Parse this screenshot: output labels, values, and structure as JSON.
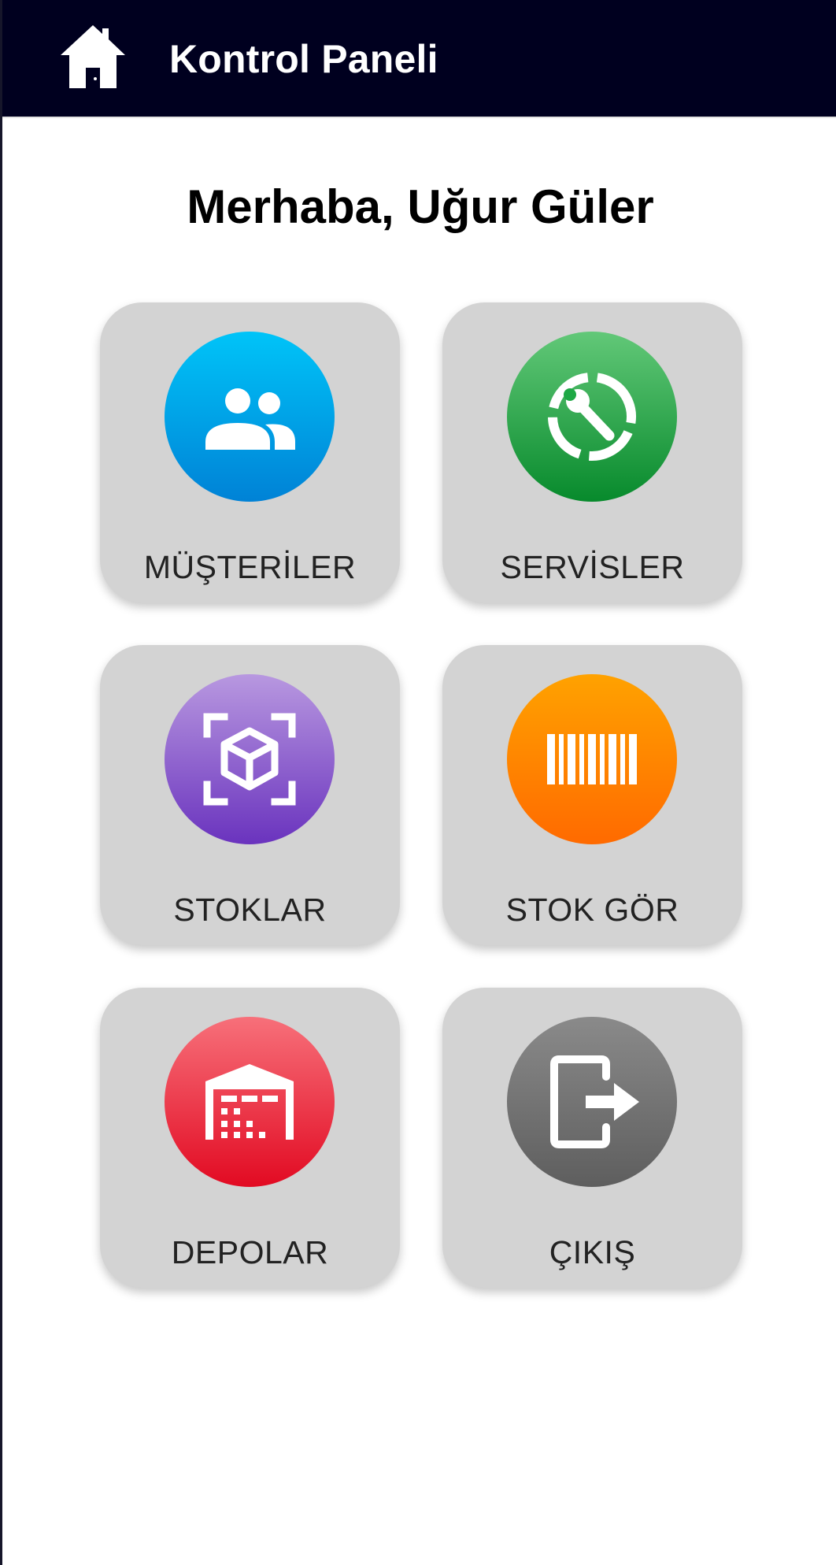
{
  "header": {
    "title": "Kontrol Paneli",
    "home_icon": "home-icon",
    "background": "#00001f"
  },
  "greeting": "Merhaba, Uğur Güler",
  "tiles": [
    {
      "label": "MÜŞTERİLER",
      "icon": "customers-icon",
      "color": "#00a8ec"
    },
    {
      "label": "SERVİSLER",
      "icon": "service-wrench-icon",
      "color": "#1ea845"
    },
    {
      "label": "STOKLAR",
      "icon": "stock-box-icon",
      "color": "#8d5fd0"
    },
    {
      "label": "STOK GÖR",
      "icon": "barcode-icon",
      "color": "#ff8800"
    },
    {
      "label": "DEPOLAR",
      "icon": "warehouse-icon",
      "color": "#ee3344"
    },
    {
      "label": "ÇIKIŞ",
      "icon": "logout-icon",
      "color": "#747474"
    }
  ]
}
